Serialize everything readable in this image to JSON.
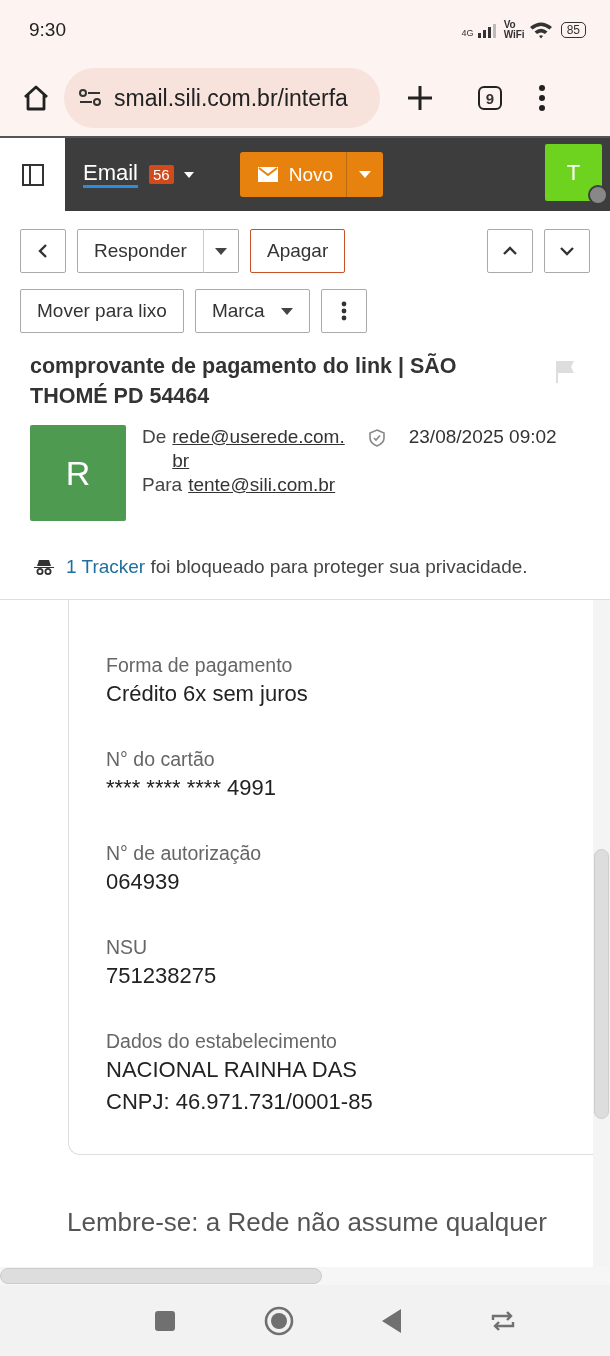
{
  "status_bar": {
    "time": "9:30",
    "network": "4G",
    "vowifi": [
      "Vo",
      "WiFi"
    ],
    "battery": "85"
  },
  "browser": {
    "url": "smail.sili.com.br/interfa",
    "tab_count": "9"
  },
  "app_header": {
    "section": "Email",
    "unread": "56",
    "compose": "Novo",
    "avatar": "T"
  },
  "toolbar": {
    "reply": "Responder",
    "delete": "Apagar",
    "move": "Mover para lixo",
    "mark": "Marca"
  },
  "message": {
    "subject": "comprovante de pagamento do link | SÃO THOMÉ PD 54464",
    "avatar": "R",
    "from_label": "De",
    "from": "rede@userede.com.br",
    "date": "23/08/2025 09:02",
    "to_label": "Para",
    "to": "tente@sili.com.br",
    "tracker_link": "1 Tracker",
    "tracker_text": "foi bloqueado para proteger sua privacidade."
  },
  "receipt": {
    "fields": [
      {
        "label": "Forma de pagamento",
        "values": [
          "Crédito 6x sem juros"
        ]
      },
      {
        "label": "N° do cartão",
        "values": [
          "**** **** **** 4991"
        ]
      },
      {
        "label": "N° de autorização",
        "values": [
          "064939"
        ]
      },
      {
        "label": "NSU",
        "values": [
          "751238275"
        ]
      },
      {
        "label": "Dados do estabelecimento",
        "values": [
          "NACIONAL RAINHA DAS",
          "CNPJ: 46.971.731/0001-85"
        ]
      }
    ]
  },
  "note": "Lembre-se: a Rede não assume qualquer"
}
